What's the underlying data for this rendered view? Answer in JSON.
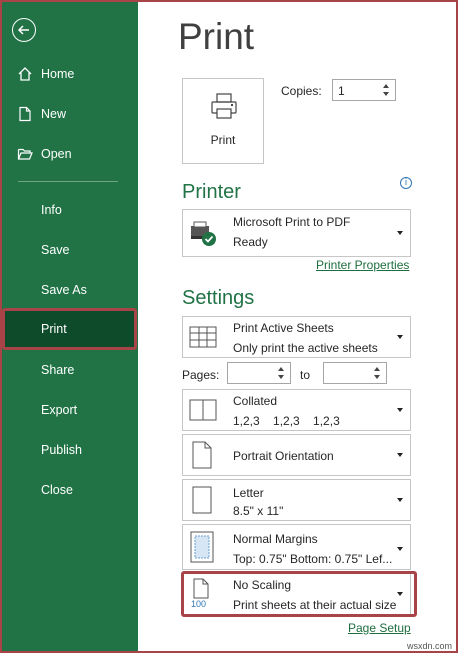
{
  "sidebar": {
    "items": [
      {
        "label": "Home",
        "icon": "home-icon"
      },
      {
        "label": "New",
        "icon": "new-document-icon"
      },
      {
        "label": "Open",
        "icon": "open-folder-icon"
      },
      {
        "label": "Info"
      },
      {
        "label": "Save"
      },
      {
        "label": "Save As"
      },
      {
        "label": "Print",
        "active": true
      },
      {
        "label": "Share"
      },
      {
        "label": "Export"
      },
      {
        "label": "Publish"
      },
      {
        "label": "Close"
      }
    ],
    "background_color": "#217346",
    "active_color": "#0e4b2b"
  },
  "main": {
    "title": "Print",
    "print_button_label": "Print",
    "copies_label": "Copies:",
    "copies_value": "1",
    "printer_heading": "Printer",
    "printer": {
      "name": "Microsoft Print to PDF",
      "status": "Ready"
    },
    "printer_properties_link": "Printer Properties",
    "settings_heading": "Settings",
    "settings": {
      "sheets": {
        "main": "Print Active Sheets",
        "sub": "Only print the active sheets"
      },
      "pages_label": "Pages:",
      "to_label": "to",
      "collated": {
        "main": "Collated",
        "sub": "1,2,3    1,2,3    1,2,3"
      },
      "orientation": {
        "main": "Portrait Orientation"
      },
      "paper": {
        "main": "Letter",
        "sub": "8.5\" x 11\""
      },
      "margins": {
        "main": "Normal Margins",
        "sub": "Top: 0.75\" Bottom: 0.75\" Lef..."
      },
      "scaling": {
        "main": "No Scaling",
        "sub": "Print sheets at their actual size",
        "icon_text": "100"
      }
    },
    "page_setup_link": "Page Setup"
  },
  "watermark": "wsxdn.com",
  "accent_color": "#217346",
  "highlight_color": "#a84448"
}
